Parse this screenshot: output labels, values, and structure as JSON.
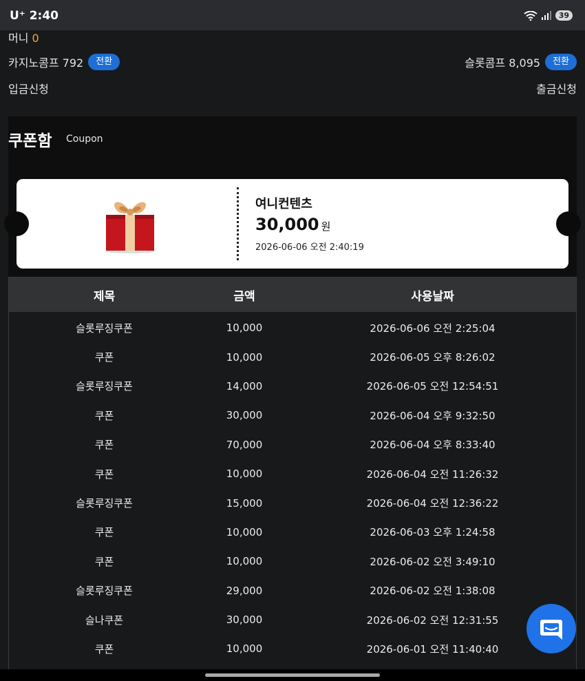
{
  "status_bar": {
    "carrier": "U⁺ 2:40",
    "battery": "39"
  },
  "account": {
    "money_label": "머니",
    "money_value": "0",
    "casino_comp_label": "카지노콤프 792",
    "slot_comp_label": "슬롯콤프 8,095",
    "convert_label": "전환",
    "deposit_label": "입금신청",
    "withdraw_label": "출금신청"
  },
  "coupon_box": {
    "title": "쿠폰함",
    "subtitle": "Coupon",
    "featured": {
      "name": "여니컨텐츠",
      "amount": "30,000",
      "unit": "원",
      "date": "2026-06-06 오전 2:40:19",
      "icon": "gift-box-icon"
    }
  },
  "table": {
    "headers": [
      "제목",
      "금액",
      "사용날짜"
    ],
    "rows": [
      [
        "슬롯루징쿠폰",
        "10,000",
        "2026-06-06 오전 2:25:04"
      ],
      [
        "쿠폰",
        "10,000",
        "2026-06-05 오후 8:26:02"
      ],
      [
        "슬롯루징쿠폰",
        "14,000",
        "2026-06-05 오전 12:54:51"
      ],
      [
        "쿠폰",
        "30,000",
        "2026-06-04 오후 9:32:50"
      ],
      [
        "쿠폰",
        "70,000",
        "2026-06-04 오후 8:33:40"
      ],
      [
        "쿠폰",
        "10,000",
        "2026-06-04 오전 11:26:32"
      ],
      [
        "슬롯루징쿠폰",
        "15,000",
        "2026-06-04 오전 12:36:22"
      ],
      [
        "쿠폰",
        "10,000",
        "2026-06-03 오후 1:24:58"
      ],
      [
        "쿠폰",
        "10,000",
        "2026-06-02 오전 3:49:10"
      ],
      [
        "슬롯루징쿠폰",
        "29,000",
        "2026-06-02 오전 1:38:08"
      ],
      [
        "슬나쿠폰",
        "30,000",
        "2026-06-02 오전 12:31:55"
      ],
      [
        "쿠폰",
        "10,000",
        "2026-06-01 오전 11:40:40"
      ]
    ]
  },
  "colors": {
    "accent_blue": "#1d6fd6",
    "money_orange": "#f0a830",
    "background": "#18191b",
    "chat_button": "#1f72e8"
  }
}
